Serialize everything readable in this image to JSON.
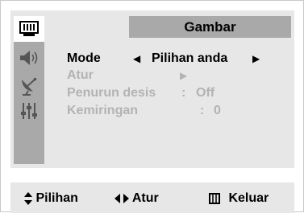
{
  "menu": {
    "title": "Gambar",
    "sidebar": [
      {
        "icon": "picture-icon",
        "active": true
      },
      {
        "icon": "speaker-icon",
        "active": false
      },
      {
        "icon": "satellite-dish-icon",
        "active": false
      },
      {
        "icon": "settings-sliders-icon",
        "active": false
      }
    ],
    "rows": [
      {
        "label": "Mode",
        "value": "Pilihan anda",
        "state": "active"
      },
      {
        "label": "Atur",
        "value": "",
        "state": "disabled"
      },
      {
        "label": "Penurun desis",
        "separator": ":",
        "value": "Off",
        "state": "disabled"
      },
      {
        "label": "Kemiringan",
        "separator": ":",
        "value": "0",
        "state": "disabled"
      }
    ]
  },
  "footer": {
    "pilihan_label": "Pilihan",
    "atur_label": "Atur",
    "keluar_label": "Keluar"
  },
  "colors": {
    "panel_bg": "#e7e7e7",
    "highlight_bg": "#a9a9a9",
    "disabled_text": "#b3b3b3",
    "text": "#000000"
  }
}
